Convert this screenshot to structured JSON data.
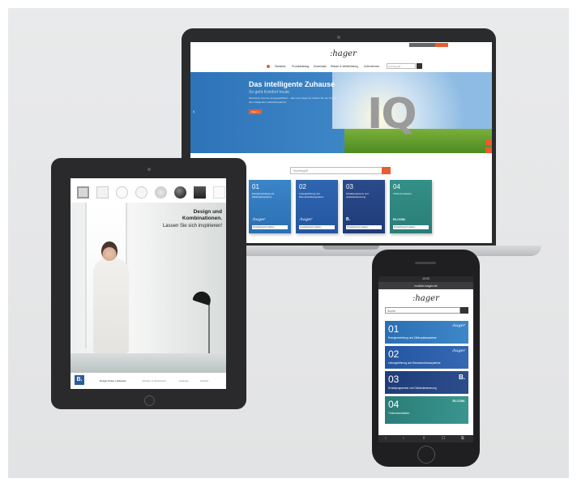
{
  "colors": {
    "hager_blue": "#2e73b8",
    "accent_orange": "#e85d2f",
    "card1": "#2b6fb3",
    "card2": "#2456a0",
    "card3": "#1f3c78",
    "card4": "#2a7d78"
  },
  "laptop": {
    "logo": ":hager",
    "nav": [
      "Startseite",
      "Produktkatalog",
      "Downloads",
      "Wissen & Weiterbildung",
      "Unternehmen"
    ],
    "nav_search": "Suchbegriff",
    "hero_title": "Das intelligente Zuhause",
    "hero_subtitle": "So geht Komfort heute",
    "hero_body": "Sicherheit, Komfort, Energieeffizienz – das neue hager IQ. Nutzen Sie die Vorteile des intelligenten Gebäudesystems.",
    "hero_button": "Mehr »",
    "hero_image_text": "IQ",
    "search_placeholder": "Suchbegriff",
    "cards": [
      {
        "num": "01",
        "text": "Energieverteilung und Zählerplatzsysteme",
        "brand": ":hager",
        "select": "Produktbereich wählen"
      },
      {
        "num": "02",
        "text": "Leitungsführung und Raumanschlusssysteme",
        "brand": ":hager",
        "select": "Produktbereich wählen"
      },
      {
        "num": "03",
        "text": "Schaltprogramme und Gebäudesteuerung",
        "brand": "B.",
        "select": "Produktbereich wählen"
      },
      {
        "num": "04",
        "text": "Türkommunikation",
        "brand": "ELCOM.",
        "select": "Produktbereich wählen"
      }
    ]
  },
  "tablet": {
    "headline_1": "Design und",
    "headline_2": "Kombinationen.",
    "headline_3": "Lassen Sie sich inspirieren!",
    "nav_logo": "B.",
    "nav": [
      "Design finden entdecken",
      "Schalter & Steckdosen",
      "Kataloge",
      "Händler"
    ]
  },
  "phone": {
    "status": "13:20",
    "url": "mobile.hager.de",
    "logo": ":hager",
    "search_placeholder": "Suche",
    "cards": [
      {
        "num": "01",
        "text": "Energieverteilung und Zählerplatzsysteme",
        "brand": ":hager"
      },
      {
        "num": "02",
        "text": "Leitungsführung und Raumanschlusssysteme",
        "brand": ":hager"
      },
      {
        "num": "03",
        "text": "Schaltprogramme und Gebäudesteuerung",
        "brand": "B."
      },
      {
        "num": "04",
        "text": "Türkommunikation",
        "brand": "ELCOM."
      }
    ],
    "toolbar": [
      "‹",
      "›",
      "⇪",
      "☐",
      "⧉"
    ]
  }
}
